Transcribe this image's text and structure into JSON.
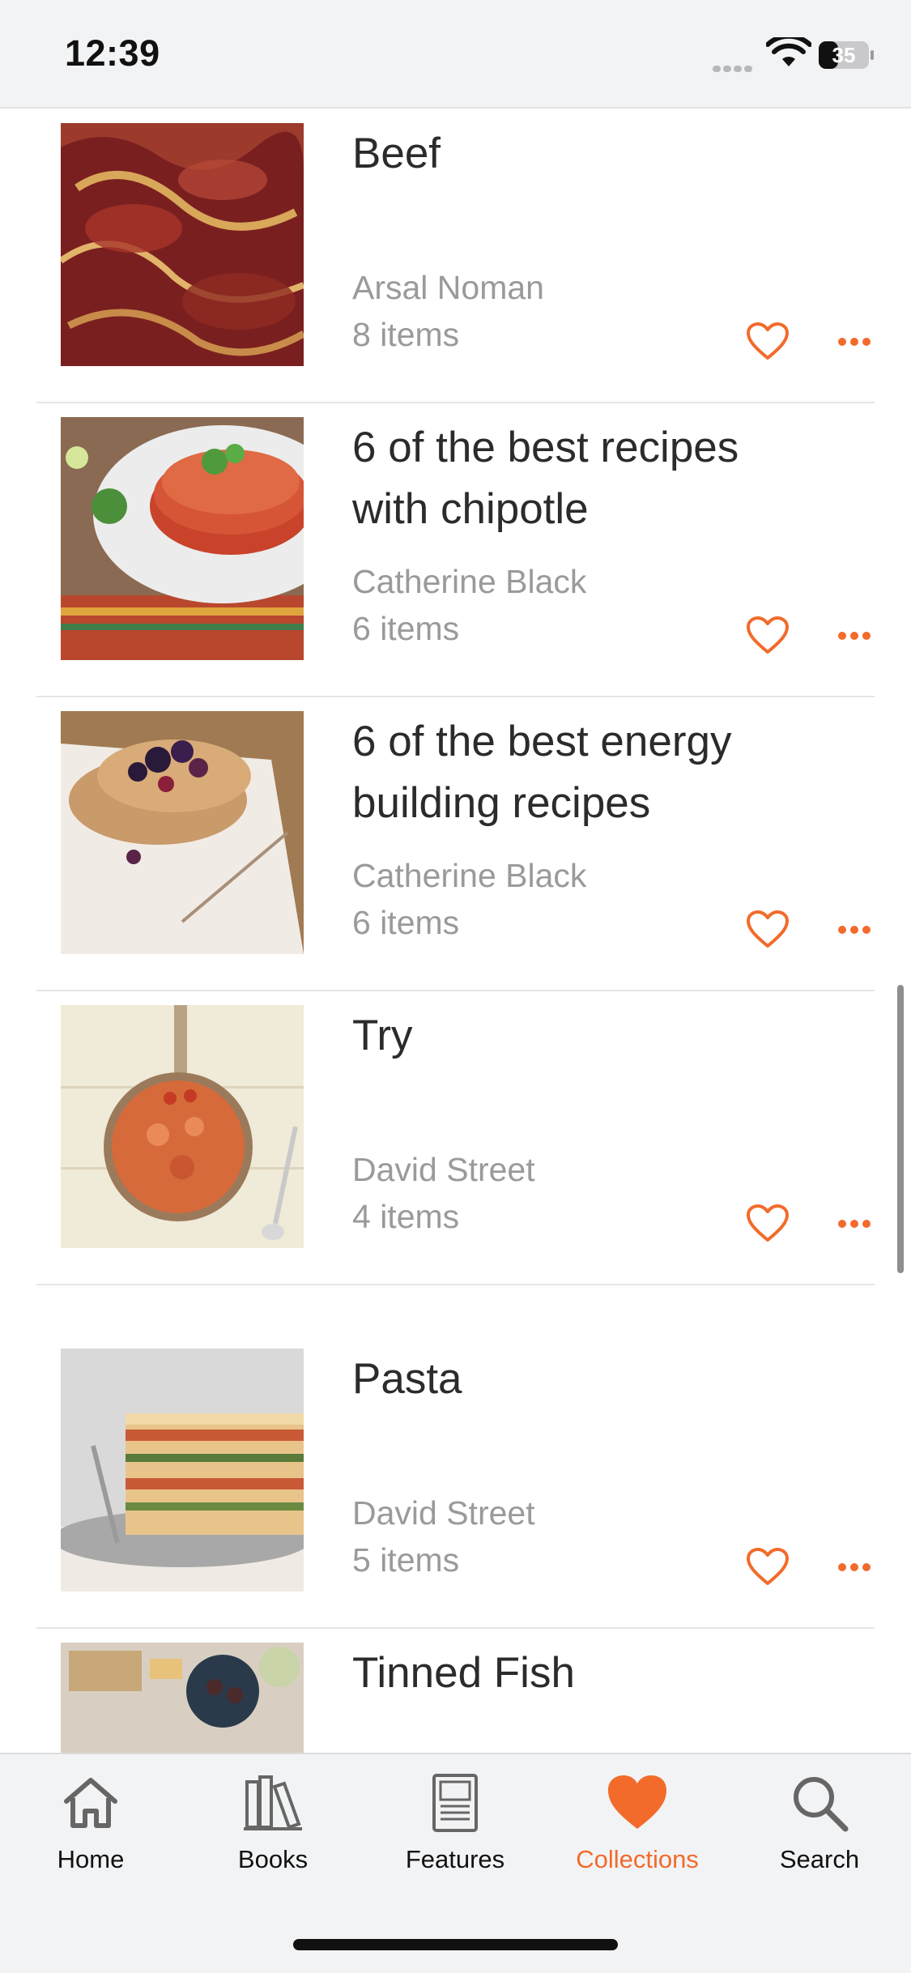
{
  "status_bar": {
    "time": "12:39",
    "battery": "35"
  },
  "collections": [
    {
      "title": "Beef",
      "author": "Arsal Noman",
      "count": "8 items"
    },
    {
      "title": "6 of the best recipes with chipotle",
      "author": "Catherine Black",
      "count": "6 items"
    },
    {
      "title": "6 of the best energy building recipes",
      "author": "Catherine Black",
      "count": "6 items"
    },
    {
      "title": "Try",
      "author": "David Street",
      "count": "4 items"
    },
    {
      "title": "Pasta",
      "author": "David Street",
      "count": "5 items"
    },
    {
      "title": "Tinned Fish",
      "author": "",
      "count": ""
    }
  ],
  "tabs": [
    {
      "label": "Home",
      "icon": "home-icon"
    },
    {
      "label": "Books",
      "icon": "books-icon"
    },
    {
      "label": "Features",
      "icon": "features-icon"
    },
    {
      "label": "Collections",
      "icon": "heart-icon",
      "active": true
    },
    {
      "label": "Search",
      "icon": "search-icon"
    }
  ],
  "colors": {
    "accent": "#f26b2b",
    "muted_text": "#9a9a9a",
    "bar_bg": "#f2f3f5"
  }
}
